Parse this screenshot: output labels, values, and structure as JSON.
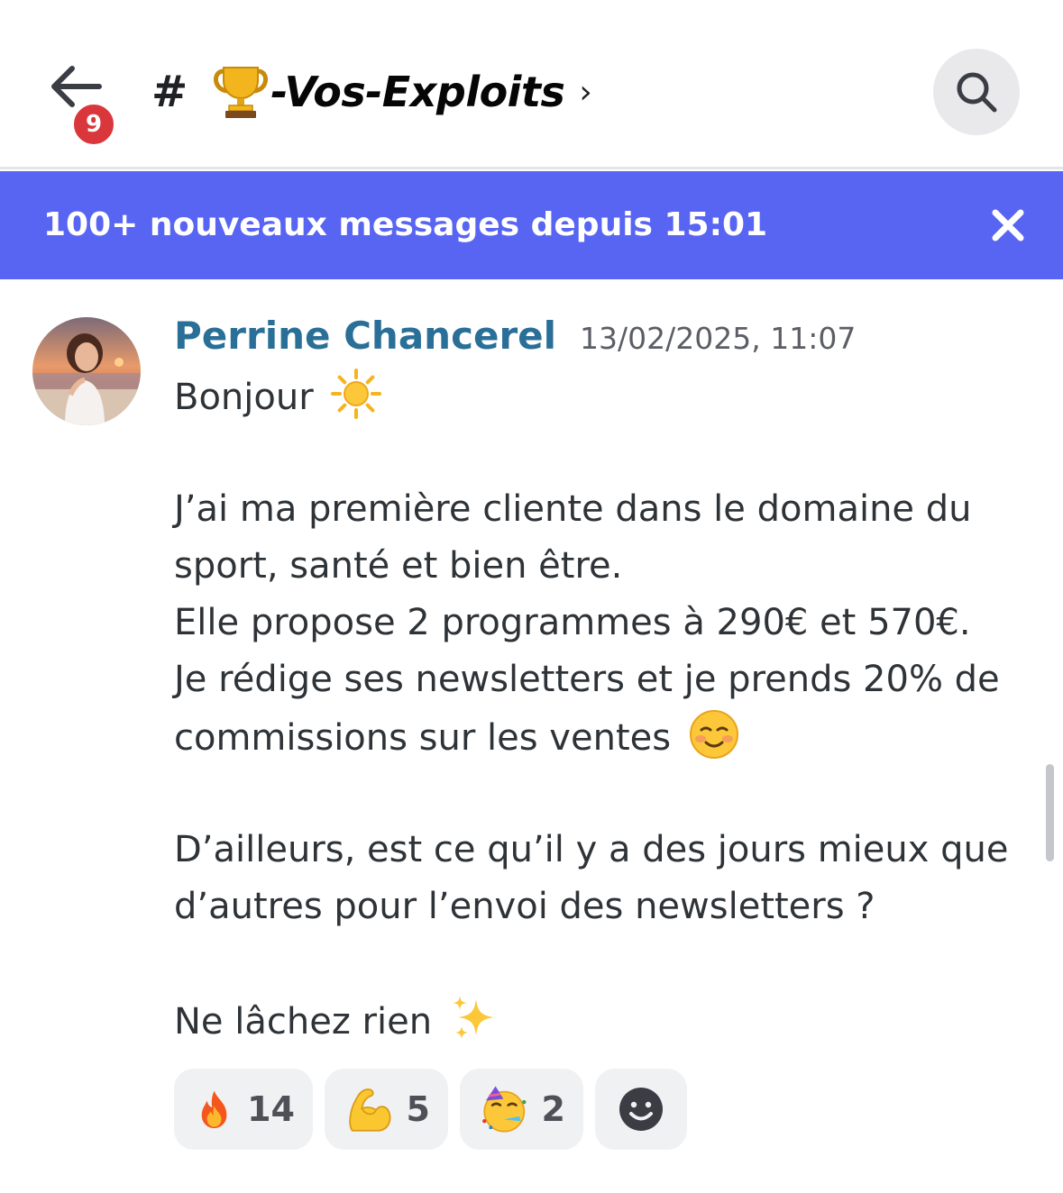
{
  "header": {
    "unread_badge": "9",
    "channel_hash": "#",
    "channel_emoji": "trophy",
    "channel_name": "-Vos-Exploits",
    "channel_chevron": "›",
    "search_icon": "search-icon"
  },
  "new_messages_bar": {
    "text": "100+ nouveaux messages depuis 15:01",
    "close_icon": "close-icon",
    "color": "#5865f2"
  },
  "message": {
    "author": "Perrine Chancerel",
    "author_color": "#2a6f97",
    "timestamp": "13/02/2025, 11:07",
    "lines": {
      "l1": "Bonjour",
      "l2": "J’ai ma première cliente dans le domaine du",
      "l3": "sport, santé et bien être.",
      "l4": "Elle propose 2 programmes à 290€ et 570€.",
      "l5": "Je rédige ses newsletters et je prends 20% de",
      "l6": "commissions sur les ventes",
      "l7": "D’ailleurs, est ce qu’il y a des jours mieux que",
      "l8": "d’autres pour l’envoi des newsletters ?",
      "l9": "Ne lâchez rien"
    },
    "emojis": {
      "after_l1": "sun",
      "after_l6": "smiling-face",
      "after_l9": "sparkles"
    }
  },
  "reactions": [
    {
      "emoji": "fire",
      "count": "14"
    },
    {
      "emoji": "flexed-biceps",
      "count": "5"
    },
    {
      "emoji": "partying-face",
      "count": "2"
    },
    {
      "emoji": "add-reaction",
      "count": ""
    }
  ]
}
